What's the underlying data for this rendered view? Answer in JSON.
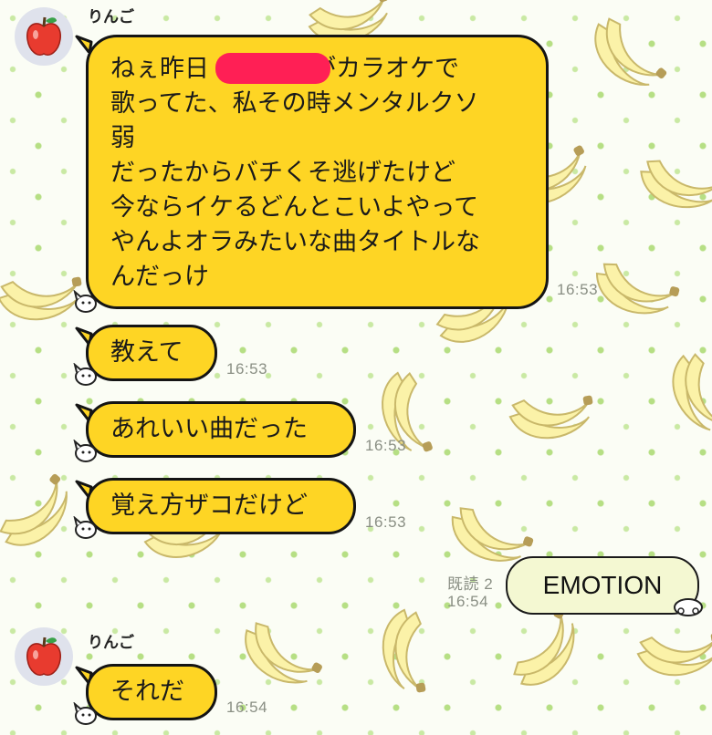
{
  "colors": {
    "bubble_in": "#fed524",
    "bubble_out": "#f4f8d2",
    "redaction": "#ff1f55",
    "timestamp": "#8a8f84"
  },
  "chat": {
    "sender_name": "りんご",
    "messages": [
      {
        "lines": [
          "ねぇ昨日",
          "がカラオケで",
          "歌ってた、私その時メンタルクソ",
          "弱",
          "だったからバチくそ逃げたけど",
          "今ならイケるどんとこいよやって",
          "やんよオラみたいな曲タイトルな",
          "んだっけ"
        ],
        "time": "16:53"
      },
      {
        "text": "教えて",
        "time": "16:53"
      },
      {
        "text": "あれいい曲だった",
        "time": "16:53"
      },
      {
        "text": "覚え方ザコだけど",
        "time": "16:53"
      },
      {
        "text": "EMOTION",
        "read": "既読 2",
        "time": "16:54"
      },
      {
        "text": "それだ",
        "time": "16:54"
      }
    ]
  }
}
